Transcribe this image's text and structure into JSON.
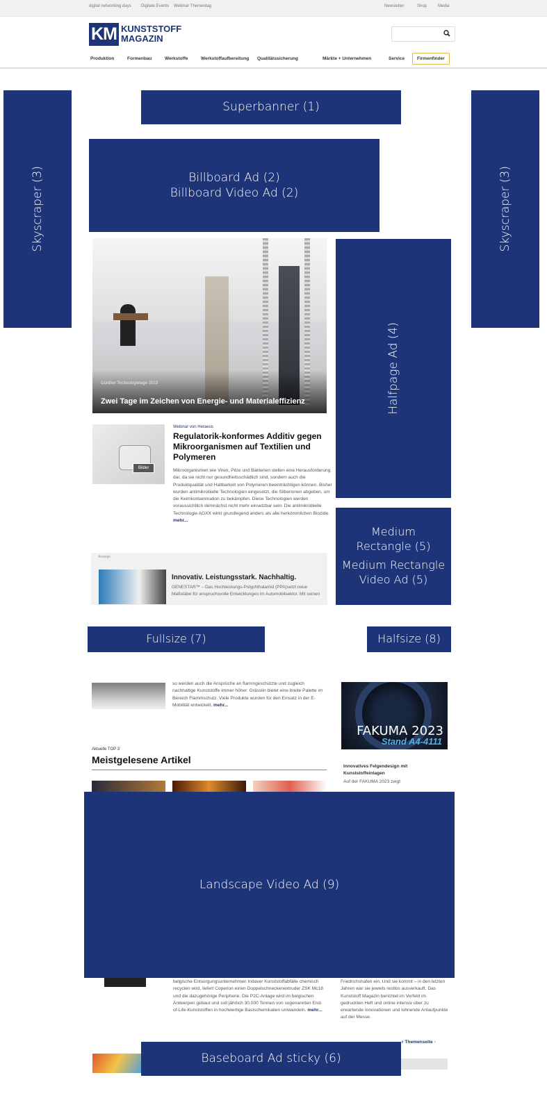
{
  "topbar": {
    "links": [
      "digital networking days",
      "Digitale Events",
      "Webinar Thementag"
    ],
    "right_links": [
      "Newsletter",
      "Shop",
      "Media"
    ]
  },
  "header": {
    "logo_mark": "KM",
    "logo_line1": "KUNSTSTOFF",
    "logo_line2": "MAGAZIN",
    "search_placeholder": ""
  },
  "nav": {
    "items": [
      "Produktion",
      "Formenbau",
      "Werkstoffe",
      "Werkstoffaufbereitung",
      "Qualitätssicherung",
      "Märkte + Unternehmen",
      "Service"
    ],
    "firmenfinder": "Firmenfinder"
  },
  "ads": {
    "superbanner": "Superbanner (1)",
    "billboard_1": "Billboard Ad (2)",
    "billboard_2": "Billboard Video Ad (2)",
    "skyscraper_left": "Skyscraper (3)",
    "skyscraper_right": "Skyscraper (3)",
    "halfpage": "Halfpage Ad (4)",
    "medium_rect_1": "Medium Rectangle (5)",
    "medium_rect_2": "Medium Rectangle Video Ad (5)",
    "fullsize": "Fullsize (7)",
    "halfsize": "Halfsize (8)",
    "landscape": "Landscape Video Ad (9)",
    "baseboard": "Baseboard Ad sticky (6)"
  },
  "hero": {
    "kicker": "Günther Technologietage 2023",
    "title": "Zwei Tage im Zeichen von Energie- und Materialeffizienz"
  },
  "article": {
    "kicker": "Webinar von Heraeus",
    "title": "Regulatorik-konformes Additiv gegen Mikroorganismen auf Textilien und Polymeren",
    "button": "Bilder",
    "body": "Mikroorganismen wie Viren, Pilze und Bakterien stellen eine Herausforderung dar, da sie nicht nur gesundheitsschädlich sind, sondern auch die Produktqualität und Haltbarkeit von Polymeren beeinträchtigen können. Bisher wurden antimikrobielle Technologien eingesetzt, die Silberionen abgeben, um die Keimkontamination zu bekämpfen. Diese Technologien werden voraussichtlich demnächst nicht mehr einsetzbar sein. Die antimikrobielle Technologie AGXX wirkt grundlegend anders als alle herkömmlichen Biozide.",
    "more": "mehr..."
  },
  "promo": {
    "label": "Anzeige",
    "title": "Innovativ. Leistungsstark. Nachhaltig.",
    "body": "GENESTAR™ – Das Hochleistungs-Polyphthalamid (PPA)setzt neue Maßstäbe für anspruchsvolle Entwicklungen im Automobilsektor. Mit seinen"
  },
  "section2": {
    "body": "so werden auch die Ansprüche an flammgeschützte und zugleich nachhaltige Kunststoffe immer höher. Grässlin bietet eine breite Palette im Bereich Flammschutz. Viele Produkte wurden für den Einsatz in der E-Mobilität entwickelt.",
    "more": "mehr..."
  },
  "sidebar": {
    "fakuma_line1": "FAKUMA 2023",
    "fakuma_line2": "Stand A4-4111",
    "title": "Innovatives Felgendesign mit Kunststoffeinlagen",
    "body": "Auf der FAKUMA 2023 zeigt"
  },
  "top3": {
    "kicker": "Aktuelle TOP 3",
    "title": "Meistgelesene Artikel"
  },
  "lower": {
    "body": "belgische Entsorgungsunternehmen Indaver Kunststoffabfälle chemisch recyclen wird, liefert Coperion einen Doppelschneckenextruder ZSK Mc18 und die dazugehörige Peripherie. Die P2C-Anlage wird im belgischen Antwerpen gebaut und soll jährlich 30.000 Tonnen von sogenannten End-of-Life-Kunststoffen in hochwertige Basischemikalien umwandeln.",
    "more": "mehr...",
    "right_body": "Friedrichshafen ein. Und sie kommt – in den letzten Jahren war sie jeweils restlos ausverkauft. Das Kunststoff Magazin berichtet im Vorfeld im gedruckten Heft und online intensiv über zu erwartende Innovationen und lohnende Anlaufpunkte auf der Messe.",
    "themen_link": "r Themenseite"
  },
  "colors": {
    "ad_blue": "#1e3478",
    "firmenfinder_border": "#e0b84a"
  }
}
